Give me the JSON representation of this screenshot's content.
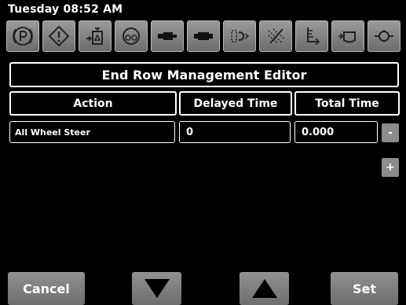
{
  "header": {
    "datetime": "Tuesday 08:52 AM"
  },
  "toolbar": {
    "icons": [
      "parking-brake-icon",
      "warning-icon",
      "hydraulic-icon",
      "engine-icon",
      "hitch-lift-icon",
      "hitch-lower-icon",
      "spray-pattern-icon",
      "spray-off-icon",
      "implement-lower-icon",
      "valve-icon",
      "pto-icon"
    ]
  },
  "editor": {
    "title": "End Row Management Editor",
    "columns": {
      "action": "Action",
      "delayed": "Delayed Time",
      "total": "Total Time"
    },
    "rows": [
      {
        "action": "All Wheel Steer",
        "delayed_time": "0",
        "total_time": "0.000"
      }
    ],
    "minus_label": "-",
    "plus_label": "+"
  },
  "footer": {
    "cancel_label": "Cancel",
    "set_label": "Set"
  }
}
